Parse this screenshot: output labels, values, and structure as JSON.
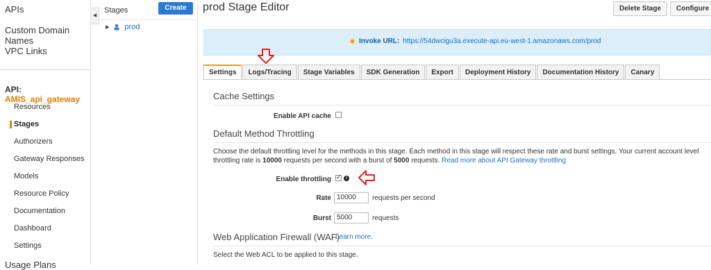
{
  "leftnav": {
    "top_links": [
      "APIs",
      "Custom Domain Names",
      "VPC Links"
    ],
    "api_prefix": "API:",
    "api_name": "AMIS_api_gateway",
    "sub_items": [
      "Resources",
      "Stages",
      "Authorizers",
      "Gateway Responses",
      "Models",
      "Resource Policy",
      "Documentation",
      "Dashboard",
      "Settings"
    ],
    "bottom_link": "Usage Plans"
  },
  "stages_panel": {
    "title": "Stages",
    "create_label": "Create",
    "tree_item": "prod"
  },
  "main": {
    "title": "prod Stage Editor",
    "delete_label": "Delete Stage",
    "configure_label": "Configure Tags",
    "invoke_label": "Invoke URL:",
    "invoke_url": "https://54dwcigu3a.execute-api.eu-west-1.amazonaws.com/prod",
    "tabs": [
      "Settings",
      "Logs/Tracing",
      "Stage Variables",
      "SDK Generation",
      "Export",
      "Deployment History",
      "Documentation History",
      "Canary"
    ]
  },
  "settings": {
    "cache_heading": "Cache Settings",
    "enable_cache_label": "Enable API cache",
    "enable_cache_checked": false,
    "throttling_heading": "Default Method Throttling",
    "para_1": "Choose the default throttling level for the methods in this stage. Each method in this stage will respect these rate and burst settings. Your current account level throttling rate is",
    "rate_limit": "10000",
    "para_2": "requests per second with a burst of",
    "burst_limit": "5000",
    "para_3": "requests.",
    "read_more": "Read more about API Gateway throttling",
    "enable_throttling_label": "Enable throttling",
    "enable_throttling_checked": true,
    "rate_label": "Rate",
    "rate_value": "10000",
    "rate_unit": "requests per second",
    "burst_label": "Burst",
    "burst_value": "5000",
    "burst_unit": "requests",
    "waf_heading": "Web Application Firewall (WAF)",
    "waf_learn": "Learn more.",
    "waf_desc": "Select the Web ACL to be applied to this stage."
  },
  "colors": {
    "accent_orange": "#e07b00",
    "primary_blue": "#2a7ad2",
    "link_blue": "#1a6fc4",
    "annotation_red": "#e02020"
  }
}
